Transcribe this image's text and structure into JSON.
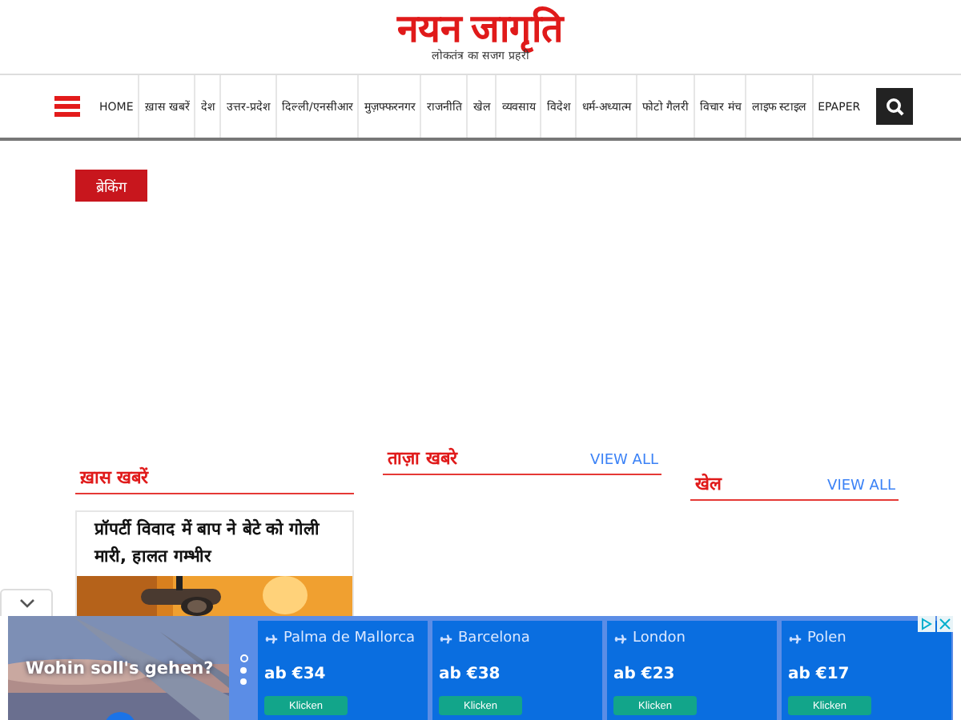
{
  "logo": {
    "title": "नयन जागृति",
    "tagline": "लोकतंत्र का सजग प्रहरी"
  },
  "nav": {
    "items": [
      "HOME",
      "ख़ास खबरें",
      "देश",
      "उत्तर-प्रदेश",
      "दिल्ली/एनसीआर",
      "मुज़फ्फरनगर",
      "राजनीति",
      "खेल",
      "व्यवसाय",
      "विदेश",
      "धर्म-अध्यात्म",
      "फोटो गैलरी",
      "विचार मंच",
      "लाइफ स्टाइल",
      "EPAPER"
    ]
  },
  "breaking": {
    "label": "ब्रेकिंग"
  },
  "sections": [
    {
      "title": "ख़ास खबरें",
      "articles": [
        {
          "headline": "प्रॉपर्टी विवाद में बाप ने बेटे को गोली मारी, हालत गम्भीर"
        }
      ]
    },
    {
      "title": "ताज़ा खबरे",
      "view_all": "VIEW ALL"
    },
    {
      "title": "खेल",
      "view_all": "VIEW ALL"
    }
  ],
  "ad": {
    "headline": "Wohin soll's gehen?",
    "offers": [
      {
        "destination": "Palma de Mallorca",
        "price": "ab €34",
        "button": "Klicken"
      },
      {
        "destination": "Barcelona",
        "price": "ab €38",
        "button": "Klicken"
      },
      {
        "destination": "London",
        "price": "ab €23",
        "button": "Klicken"
      },
      {
        "destination": "Polen",
        "price": "ab €17",
        "button": "Klicken"
      }
    ]
  }
}
